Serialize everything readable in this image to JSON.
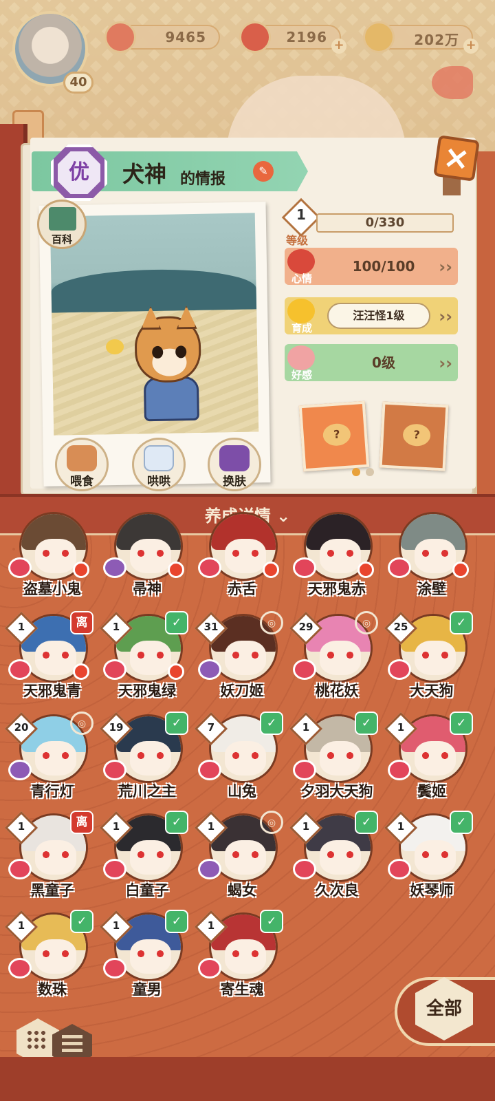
{
  "resources": [
    {
      "icon": "flower-coin-icon",
      "value": "9465"
    },
    {
      "icon": "magatama-icon",
      "value": "2196"
    },
    {
      "icon": "gold-coin-icon",
      "value": "202万"
    }
  ],
  "player": {
    "level": "40"
  },
  "shikigami": {
    "rarity": "优",
    "name": "犬神",
    "title_suffix": "的情报",
    "encyclopedia_label": "百科",
    "level": "1",
    "level_label": "等级",
    "exp": "0/330",
    "mood_label": "心情",
    "mood": "100/100",
    "growth_label": "育成",
    "growth": "汪汪怪1级",
    "favor_label": "好感",
    "favor": "0级"
  },
  "actions": {
    "feed": "喂食",
    "coax": "哄哄",
    "skin": "换肤"
  },
  "cards": [
    "?",
    "?"
  ],
  "detail_label": "养成详情",
  "colors": {
    "active_dot": "#e8a13a",
    "inactive_dot": "#d8c7ac"
  },
  "grid": [
    {
      "name": "盗墓小鬼",
      "level": "",
      "tag": "",
      "heart": "red",
      "reddot": true,
      "hair": "#6b4b34"
    },
    {
      "name": "帚神",
      "level": "",
      "tag": "",
      "heart": "purple",
      "reddot": true,
      "hair": "#3c3836"
    },
    {
      "name": "赤舌",
      "level": "",
      "tag": "",
      "heart": "red",
      "reddot": true,
      "hair": "#b2322c"
    },
    {
      "name": "天邪鬼赤",
      "level": "",
      "tag": "",
      "heart": "red",
      "reddot": true,
      "hair": "#2b2226"
    },
    {
      "name": "涂壁",
      "level": "",
      "tag": "",
      "heart": "red",
      "reddot": true,
      "hair": "#7f8b86"
    },
    {
      "name": "天邪鬼青",
      "level": "1",
      "tag": "离",
      "heart": "red",
      "reddot": true,
      "hair": "#3d6fb1"
    },
    {
      "name": "天邪鬼绿",
      "level": "1",
      "tag": "✓",
      "heart": "red",
      "reddot": true,
      "hair": "#5e9e50"
    },
    {
      "name": "妖刀姬",
      "level": "31",
      "tag": "ring",
      "heart": "purple",
      "reddot": false,
      "hair": "#5b2f22"
    },
    {
      "name": "桃花妖",
      "level": "29",
      "tag": "ring",
      "heart": "red",
      "reddot": false,
      "hair": "#e884b2"
    },
    {
      "name": "大天狗",
      "level": "25",
      "tag": "✓",
      "heart": "red",
      "reddot": false,
      "hair": "#e7b545"
    },
    {
      "name": "青行灯",
      "level": "20",
      "tag": "ring",
      "heart": "purple",
      "reddot": false,
      "hair": "#8fcfe6"
    },
    {
      "name": "荒川之主",
      "level": "19",
      "tag": "✓",
      "heart": "red",
      "reddot": false,
      "hair": "#2a3a4e"
    },
    {
      "name": "山兔",
      "level": "7",
      "tag": "✓",
      "heart": "red",
      "reddot": false,
      "hair": "#f0ece6"
    },
    {
      "name": "夕羽大天狗",
      "level": "1",
      "tag": "✓",
      "heart": "red",
      "reddot": false,
      "hair": "#c3b8a6"
    },
    {
      "name": "鬓姬",
      "level": "1",
      "tag": "✓",
      "heart": "red",
      "reddot": false,
      "hair": "#e05c6f"
    },
    {
      "name": "黑童子",
      "level": "1",
      "tag": "离",
      "heart": "red",
      "reddot": false,
      "hair": "#e9e4df"
    },
    {
      "name": "白童子",
      "level": "1",
      "tag": "✓",
      "heart": "red",
      "reddot": false,
      "hair": "#2b2a2e"
    },
    {
      "name": "蝎女",
      "level": "1",
      "tag": "ring",
      "heart": "purple",
      "reddot": false,
      "hair": "#3a3134"
    },
    {
      "name": "久次良",
      "level": "1",
      "tag": "✓",
      "heart": "red",
      "reddot": false,
      "hair": "#3f3b46"
    },
    {
      "name": "妖琴师",
      "level": "1",
      "tag": "✓",
      "heart": "red",
      "reddot": false,
      "hair": "#f3f1ee"
    },
    {
      "name": "数珠",
      "level": "1",
      "tag": "✓",
      "heart": "red",
      "reddot": false,
      "hair": "#e7bb56"
    },
    {
      "name": "童男",
      "level": "1",
      "tag": "✓",
      "heart": "red",
      "reddot": false,
      "hair": "#3e5a9a"
    },
    {
      "name": "寄生魂",
      "level": "1",
      "tag": "✓",
      "heart": "red",
      "reddot": false,
      "hair": "#b83434"
    }
  ],
  "filter_label": "全部"
}
